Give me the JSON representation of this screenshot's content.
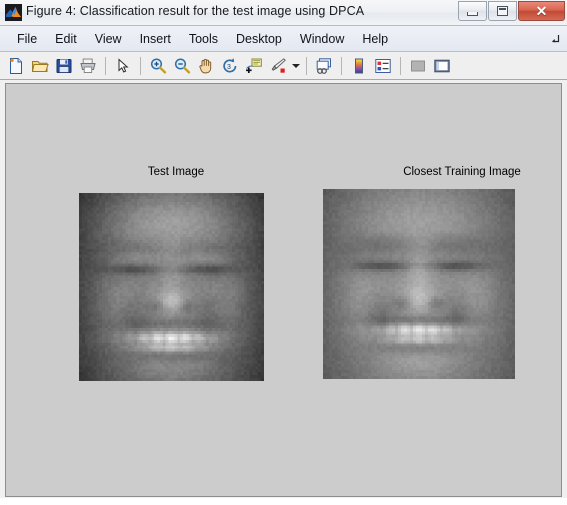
{
  "window": {
    "title": "Figure 4: Classification result for the test image using DPCA",
    "app_icon": "matlab-membrane-icon",
    "controls": {
      "minimize": "minimize-button",
      "maximize": "maximize-button",
      "close_label": "✕"
    },
    "colors": {
      "titlebar": "#eef0f3",
      "menubar": "#e7ebf3",
      "toolbar": "#efefef",
      "figure_background": "#cccccc",
      "close_button": "#c14a35",
      "border": "#8d8d8d"
    }
  },
  "menubar": {
    "items": [
      {
        "label": "File"
      },
      {
        "label": "Edit"
      },
      {
        "label": "View"
      },
      {
        "label": "Insert"
      },
      {
        "label": "Tools"
      },
      {
        "label": "Desktop"
      },
      {
        "label": "Window"
      },
      {
        "label": "Help"
      }
    ],
    "dock_control": "undock-arrow-icon"
  },
  "toolbar": {
    "buttons": [
      {
        "name": "new-figure-icon",
        "tooltip": "New Figure"
      },
      {
        "name": "open-file-icon",
        "tooltip": "Open File"
      },
      {
        "name": "save-figure-icon",
        "tooltip": "Save Figure"
      },
      {
        "name": "print-figure-icon",
        "tooltip": "Print Figure"
      },
      {
        "name": "pointer-select-icon",
        "tooltip": "Edit Plot"
      },
      {
        "name": "zoom-in-icon",
        "tooltip": "Zoom In"
      },
      {
        "name": "zoom-out-icon",
        "tooltip": "Zoom Out"
      },
      {
        "name": "pan-hand-icon",
        "tooltip": "Pan"
      },
      {
        "name": "rotate-3d-icon",
        "tooltip": "Rotate 3D"
      },
      {
        "name": "data-cursor-icon",
        "tooltip": "Data Cursor"
      },
      {
        "name": "brush-select-icon",
        "tooltip": "Brush/Select Data"
      },
      {
        "name": "link-plot-icon",
        "tooltip": "Link Plot"
      },
      {
        "name": "colorbar-icon",
        "tooltip": "Insert Colorbar"
      },
      {
        "name": "legend-icon",
        "tooltip": "Insert Legend"
      },
      {
        "name": "hide-plot-tools-icon",
        "tooltip": "Hide Plot Tools"
      },
      {
        "name": "show-plot-tools-icon",
        "tooltip": "Show Plot Tools and Dock Figure"
      }
    ]
  },
  "figure": {
    "axes": [
      {
        "name": "test-image-axes",
        "title": "Test Image",
        "image": {
          "name": "test-face-image",
          "description": "grayscale low-resolution frontal face photograph, smiling with closed eyes",
          "colormap": "gray",
          "tone": "dark"
        }
      },
      {
        "name": "closest-training-image-axes",
        "title": "Closest Training Image",
        "image": {
          "name": "closest-training-face-image",
          "description": "grayscale low-resolution frontal face photograph, smiling showing teeth",
          "colormap": "gray",
          "tone": "mid"
        }
      }
    ]
  }
}
